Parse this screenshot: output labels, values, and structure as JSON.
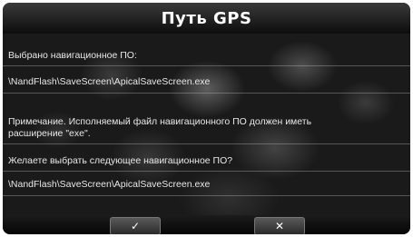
{
  "dialog": {
    "title": "Путь GPS",
    "label_selected": "Выбрано навигационное ПО:",
    "selected_path": "\\NandFlash\\SaveScreen\\ApicalSaveScreen.exe",
    "note_line1": "Примечание. Исполняемый файл навигационного ПО должен иметь",
    "note_line2": "расширение \"exe\".",
    "question": "Желаете выбрать следующее навигационное ПО?",
    "next_path": "\\NandFlash\\SaveScreen\\ApicalSaveScreen.exe"
  },
  "buttons": {
    "confirm_glyph": "✓",
    "cancel_glyph": "✕"
  },
  "icons": {
    "confirm": "checkmark-icon",
    "cancel": "close-icon"
  }
}
